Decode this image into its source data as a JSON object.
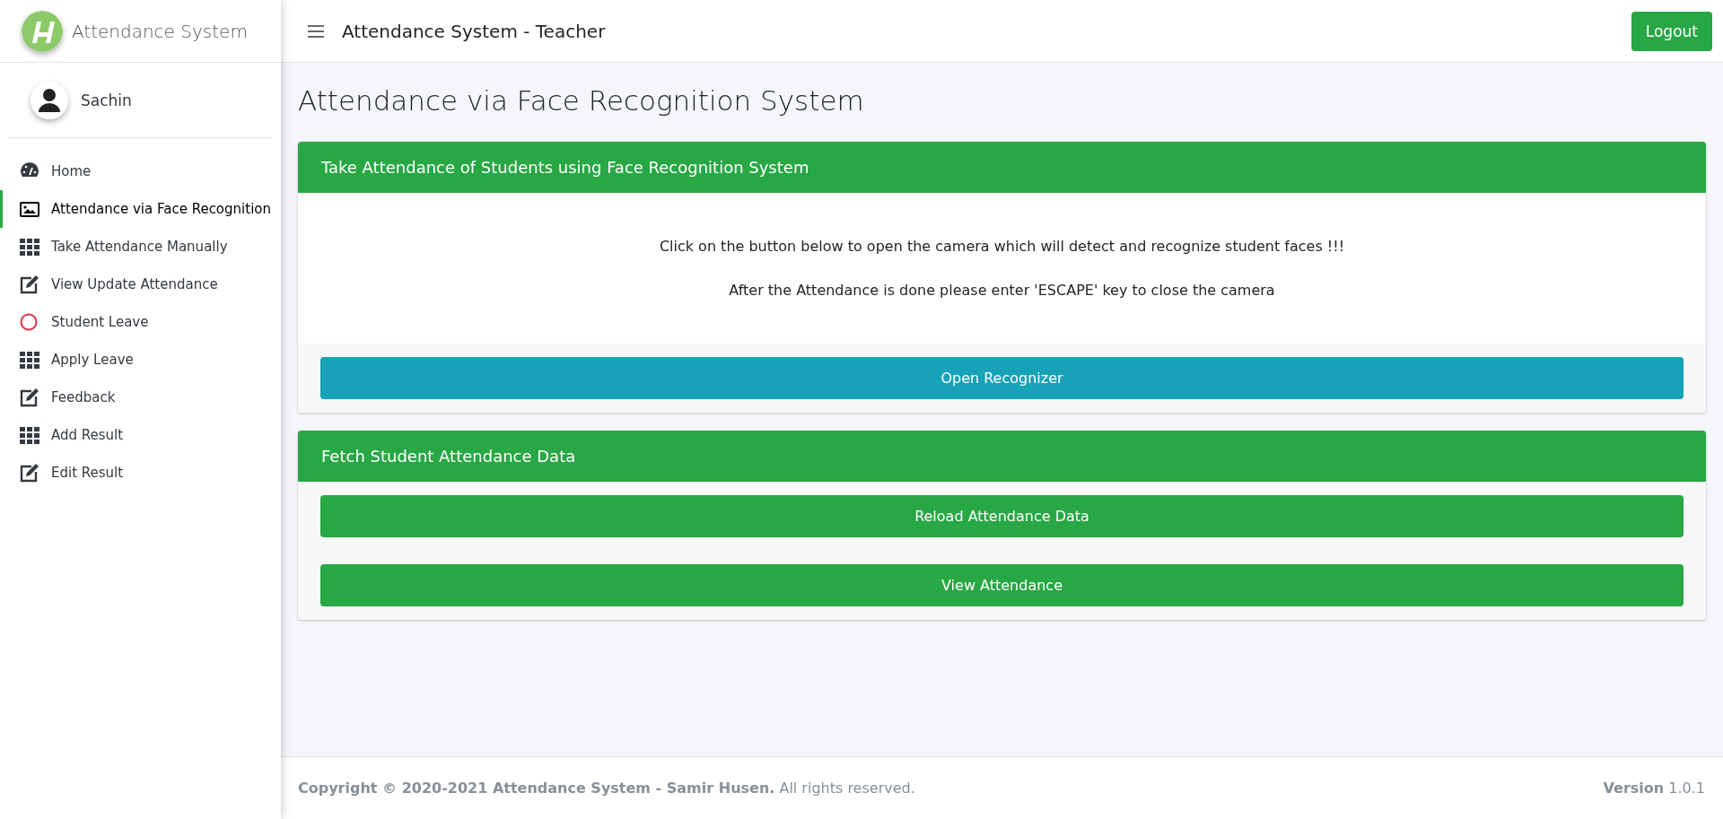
{
  "brand": {
    "name": "Attendance System"
  },
  "user": {
    "name": "Sachin"
  },
  "sidebar": {
    "items": [
      {
        "label": "Home",
        "kind": "gauge",
        "selected": false
      },
      {
        "label": "Attendance via Face Recognition",
        "kind": "image",
        "selected": true
      },
      {
        "label": "Take Attendance Manually",
        "kind": "grid",
        "selected": false
      },
      {
        "label": "View Update Attendance",
        "kind": "edit",
        "selected": false
      },
      {
        "label": "Student Leave",
        "kind": "circle",
        "selected": false
      },
      {
        "label": "Apply Leave",
        "kind": "grid",
        "selected": false
      },
      {
        "label": "Feedback",
        "kind": "edit",
        "selected": false
      },
      {
        "label": "Add Result",
        "kind": "grid",
        "selected": false
      },
      {
        "label": "Edit Result",
        "kind": "edit",
        "selected": false
      }
    ]
  },
  "topbar": {
    "title": "Attendance System - Teacher",
    "logout": "Logout"
  },
  "page_title": "Attendance via Face Recognition System",
  "cards": [
    {
      "title": "Take Attendance of Students using Face Recognition System",
      "lines": [
        "Click on the button below to open the camera which will detect and recognize student faces !!!",
        "After the Attendance is done please enter 'ESCAPE' key to close the camera"
      ],
      "buttons": [
        {
          "label": "Open Recognizer",
          "kind": "info"
        }
      ]
    },
    {
      "title": "Fetch Student Attendance Data",
      "buttons": [
        {
          "label": "Reload Attendance Data",
          "kind": "success"
        },
        {
          "label": "View Attendance",
          "kind": "success"
        }
      ]
    }
  ],
  "footer": {
    "copyright": "**Copyright © 2020-2021 Attendance System - Samir Husen.** All rights reserved.",
    "version": "**Version** 1.0.1"
  }
}
